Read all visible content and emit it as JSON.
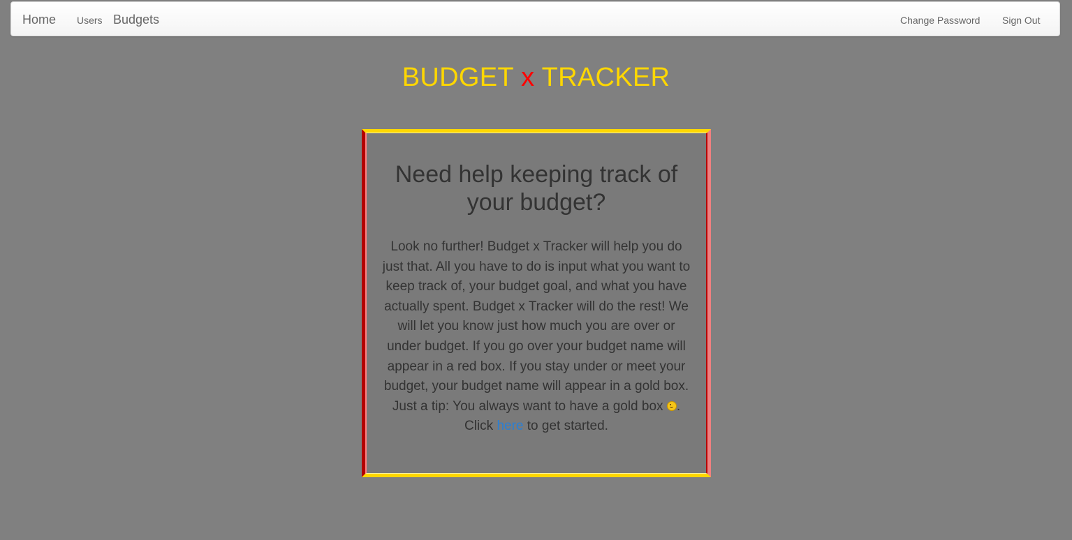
{
  "nav": {
    "home": "Home",
    "users": "Users",
    "budgets": "Budgets",
    "change_password": "Change Password",
    "sign_out": "Sign Out"
  },
  "brand": {
    "part1": "BUDGET",
    "x": "x",
    "part2": "TRACKER"
  },
  "info": {
    "heading": "Need help keeping track of your budget?",
    "body_before_link": "Look no further! Budget x Tracker will help you do just that. All you have to do is input what you want to keep track of, your budget goal, and what you have actually spent. Budget x Tracker will do the rest! We will let you know just how much you are over or under budget. If you go over your budget name will appear in a red box. If you stay under or meet your budget, your budget name will appear in a gold box. Just a tip: You always want to have a gold box",
    "body_after_emoji": ". Click",
    "link_text": "here",
    "body_after_link": "to get started."
  },
  "colors": {
    "background": "#808080",
    "brand_yellow": "#ffd700",
    "brand_red": "#ff0000",
    "link_blue": "#2a7fd4"
  },
  "icons": {
    "emoji": "wink-smiley-icon"
  }
}
